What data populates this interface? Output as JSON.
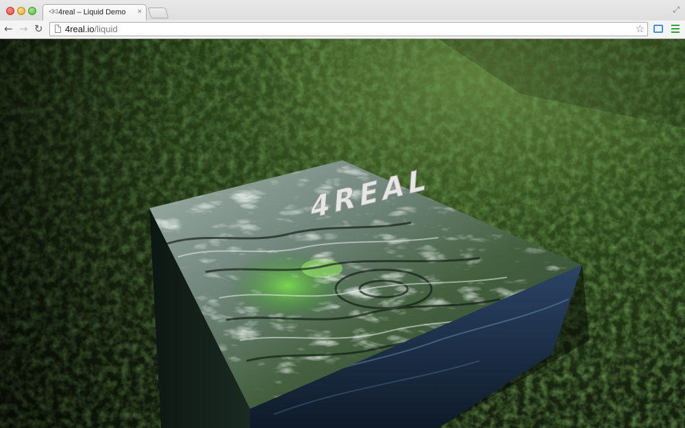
{
  "window": {
    "tab": {
      "favicon": "◁◁",
      "title": "4real – Liquid Demo",
      "close_glyph": "×"
    },
    "fullscreen_glyph": "⤢"
  },
  "toolbar": {
    "back_glyph": "←",
    "forward_glyph": "→",
    "reload_glyph": "↻",
    "url_host": "4real.io",
    "url_path": "/liquid",
    "star_glyph": "☆"
  },
  "scene": {
    "logo_text": "4REAL",
    "colors": {
      "grass_dark": "#17230f",
      "grass_mid": "#2e4a1c",
      "grass_light": "#5f7d3a",
      "water_top": "#7c8e86",
      "water_highlight": "#dfe7e2",
      "water_green": "#5fbf3e",
      "water_side": "#17283a",
      "water_front": "#20354f"
    }
  }
}
